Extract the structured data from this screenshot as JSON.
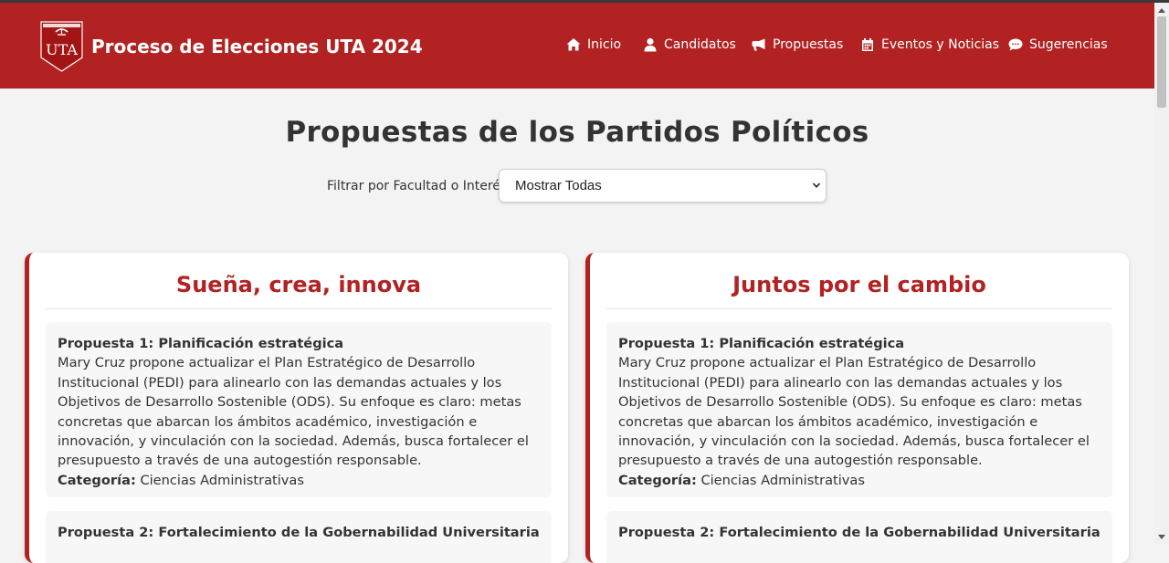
{
  "header": {
    "logo_text": "UTA",
    "title": "Proceso de Elecciones UTA 2024",
    "nav": [
      {
        "label": "Inicio",
        "icon": "home-icon"
      },
      {
        "label": "Candidatos",
        "icon": "user-icon"
      },
      {
        "label": "Propuestas",
        "icon": "megaphone-icon"
      },
      {
        "label": "Eventos y Noticias",
        "icon": "calendar-icon"
      },
      {
        "label": "Sugerencias",
        "icon": "comment-icon"
      }
    ]
  },
  "main": {
    "heading": "Propuestas de los Partidos Políticos",
    "filter": {
      "label": "Filtrar por Facultad o Interés:",
      "selected": "Mostrar Todas"
    },
    "parties": [
      {
        "name": "Sueña, crea, innova",
        "proposals": [
          {
            "title": "Propuesta 1: Planificación estratégica",
            "description": "Mary Cruz propone actualizar el Plan Estratégico de Desarrollo Institucional (PEDI) para alinearlo con las demandas actuales y los Objetivos de Desarrollo Sostenible (ODS). Su enfoque es claro: metas concretas que abarcan los ámbitos académico, investigación e innovación, y vinculación con la sociedad. Además, busca fortalecer el presupuesto a través de una autogestión responsable.",
            "category_label": "Categoría:",
            "category": "Ciencias Administrativas"
          },
          {
            "title": "Propuesta 2: Fortalecimiento de la Gobernabilidad Universitaria"
          }
        ]
      },
      {
        "name": "Juntos por el cambio",
        "proposals": [
          {
            "title": "Propuesta 1: Planificación estratégica",
            "description": "Mary Cruz propone actualizar el Plan Estratégico de Desarrollo Institucional (PEDI) para alinearlo con las demandas actuales y los Objetivos de Desarrollo Sostenible (ODS). Su enfoque es claro: metas concretas que abarcan los ámbitos académico, investigación e innovación, y vinculación con la sociedad. Además, busca fortalecer el presupuesto a través de una autogestión responsable.",
            "category_label": "Categoría:",
            "category": "Ciencias Administrativas"
          },
          {
            "title": "Propuesta 2: Fortalecimiento de la Gobernabilidad Universitaria"
          }
        ]
      }
    ]
  },
  "colors": {
    "brand": "#b22222",
    "background": "#f3f3f3",
    "card": "#ffffff",
    "proposal_bg": "#f7f7f7"
  }
}
